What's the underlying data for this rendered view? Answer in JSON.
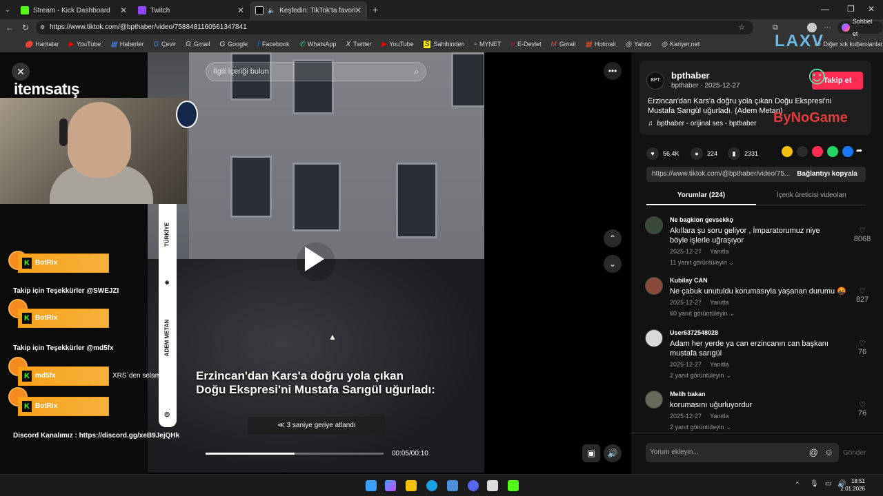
{
  "browser": {
    "tabs": [
      {
        "label": "Stream - Kick Dashboard",
        "color": "#53fc18"
      },
      {
        "label": "Twitch",
        "color": "#9146ff"
      },
      {
        "label": "Keşfedin: TikTok'ta favori vide",
        "color": "#111111"
      }
    ],
    "url": "https://www.tiktok.com/@bpthaber/video/7588481160561347841",
    "profile_btn": "Sohbet et",
    "bookmarks": [
      "Haritalar",
      "YouTube",
      "Haberler",
      "Çevir",
      "Gmail",
      "Google",
      "Facebook",
      "WhatsApp",
      "Twitter",
      "YouTube",
      "Sahibinden",
      "MYNET",
      "E-Devlet",
      "Gmail",
      "Hotmail",
      "Yahoo",
      "Kariyer.net"
    ],
    "other_bookmarks": "Diğer sık kullanılanlar"
  },
  "overlay": {
    "brand": "itemsatış",
    "alerts": [
      {
        "name": "BotRix",
        "message": "Takip için Teşekkürler @SWEJZI"
      },
      {
        "name": "BotRix",
        "message": "Takip için Teşekkürler @md5fx"
      },
      {
        "name": "md5fx",
        "message": "XRS`den selam"
      },
      {
        "name": "BotRix",
        "message": ""
      }
    ],
    "discord": "Discord Kanalımız : https://discord.gg/xeB9JejQHk",
    "right_logo": "ByNoGame",
    "top_logo": "LAXV"
  },
  "video": {
    "search_placeholder": "İlgili içeriği bulun",
    "caption_line1": "Erzincan'dan Kars'a doğru yola çıkan",
    "caption_line2": "Doğu Ekspresi'ni Mustafa Sarıgül uğurladı:",
    "rewind_text": "3 saniye geriye atlandı",
    "time": "00:05/00:10",
    "progress": 0.5,
    "strip_top": "TÜRKİYE",
    "strip_bottom": "ADEM METAN"
  },
  "post": {
    "username": "bpthaber",
    "handle_date": "bpthaber · 2025-12-27",
    "follow_label": "Takip et",
    "description": "Erzincan'dan Kars'a doğru yola çıkan Doğu Ekspresi'ni Mustafa Sarıgül uğurladı. (Adem Metan)",
    "sound": "bpthaber - orijinal ses - bpthaber",
    "likes": "56.4K",
    "comments": "224",
    "saves": "2331",
    "link": "https://www.tiktok.com/@bpthaber/video/75...",
    "copy_label": "Bağlantıyı kopyala",
    "tab_comments": "Yorumlar (224)",
    "tab_creator": "İçerik üreticisi videoları"
  },
  "comments": [
    {
      "user": "Ne bagkion gevsekkϙ",
      "text": "Akıllara şu soru geliyor , İmparatorumuz niye böyle işlerle uğraşıyor",
      "date": "2025-12-27",
      "reply": "Yanıtla",
      "replies": "11 yanıt görüntüleyin",
      "likes": "8068"
    },
    {
      "user": "Kubilay CAN",
      "text": "Ne çabuk unutuldu korumasıyla yaşanan durumu 🤬",
      "date": "2025-12-27",
      "reply": "Yanıtla",
      "replies": "60 yanıt görüntüleyin",
      "likes": "827"
    },
    {
      "user": "User6372548028",
      "text": "Adam her yerde ya can erzincanın can başkanı mustafa sarıgül",
      "date": "2025-12-27",
      "reply": "Yanıtla",
      "replies": "2 yanıt görüntüleyin",
      "likes": "76"
    },
    {
      "user": "Melih bakan",
      "text": "korumasını uğurluyordur",
      "date": "2025-12-27",
      "reply": "Yanıtla",
      "replies": "2 yanıt görüntüleyin",
      "likes": "76"
    }
  ],
  "comment_input": {
    "placeholder": "Yorum ekleyin...",
    "send": "Gönder"
  },
  "taskbar": {
    "time": "18:51",
    "date": "2.01.2026"
  }
}
